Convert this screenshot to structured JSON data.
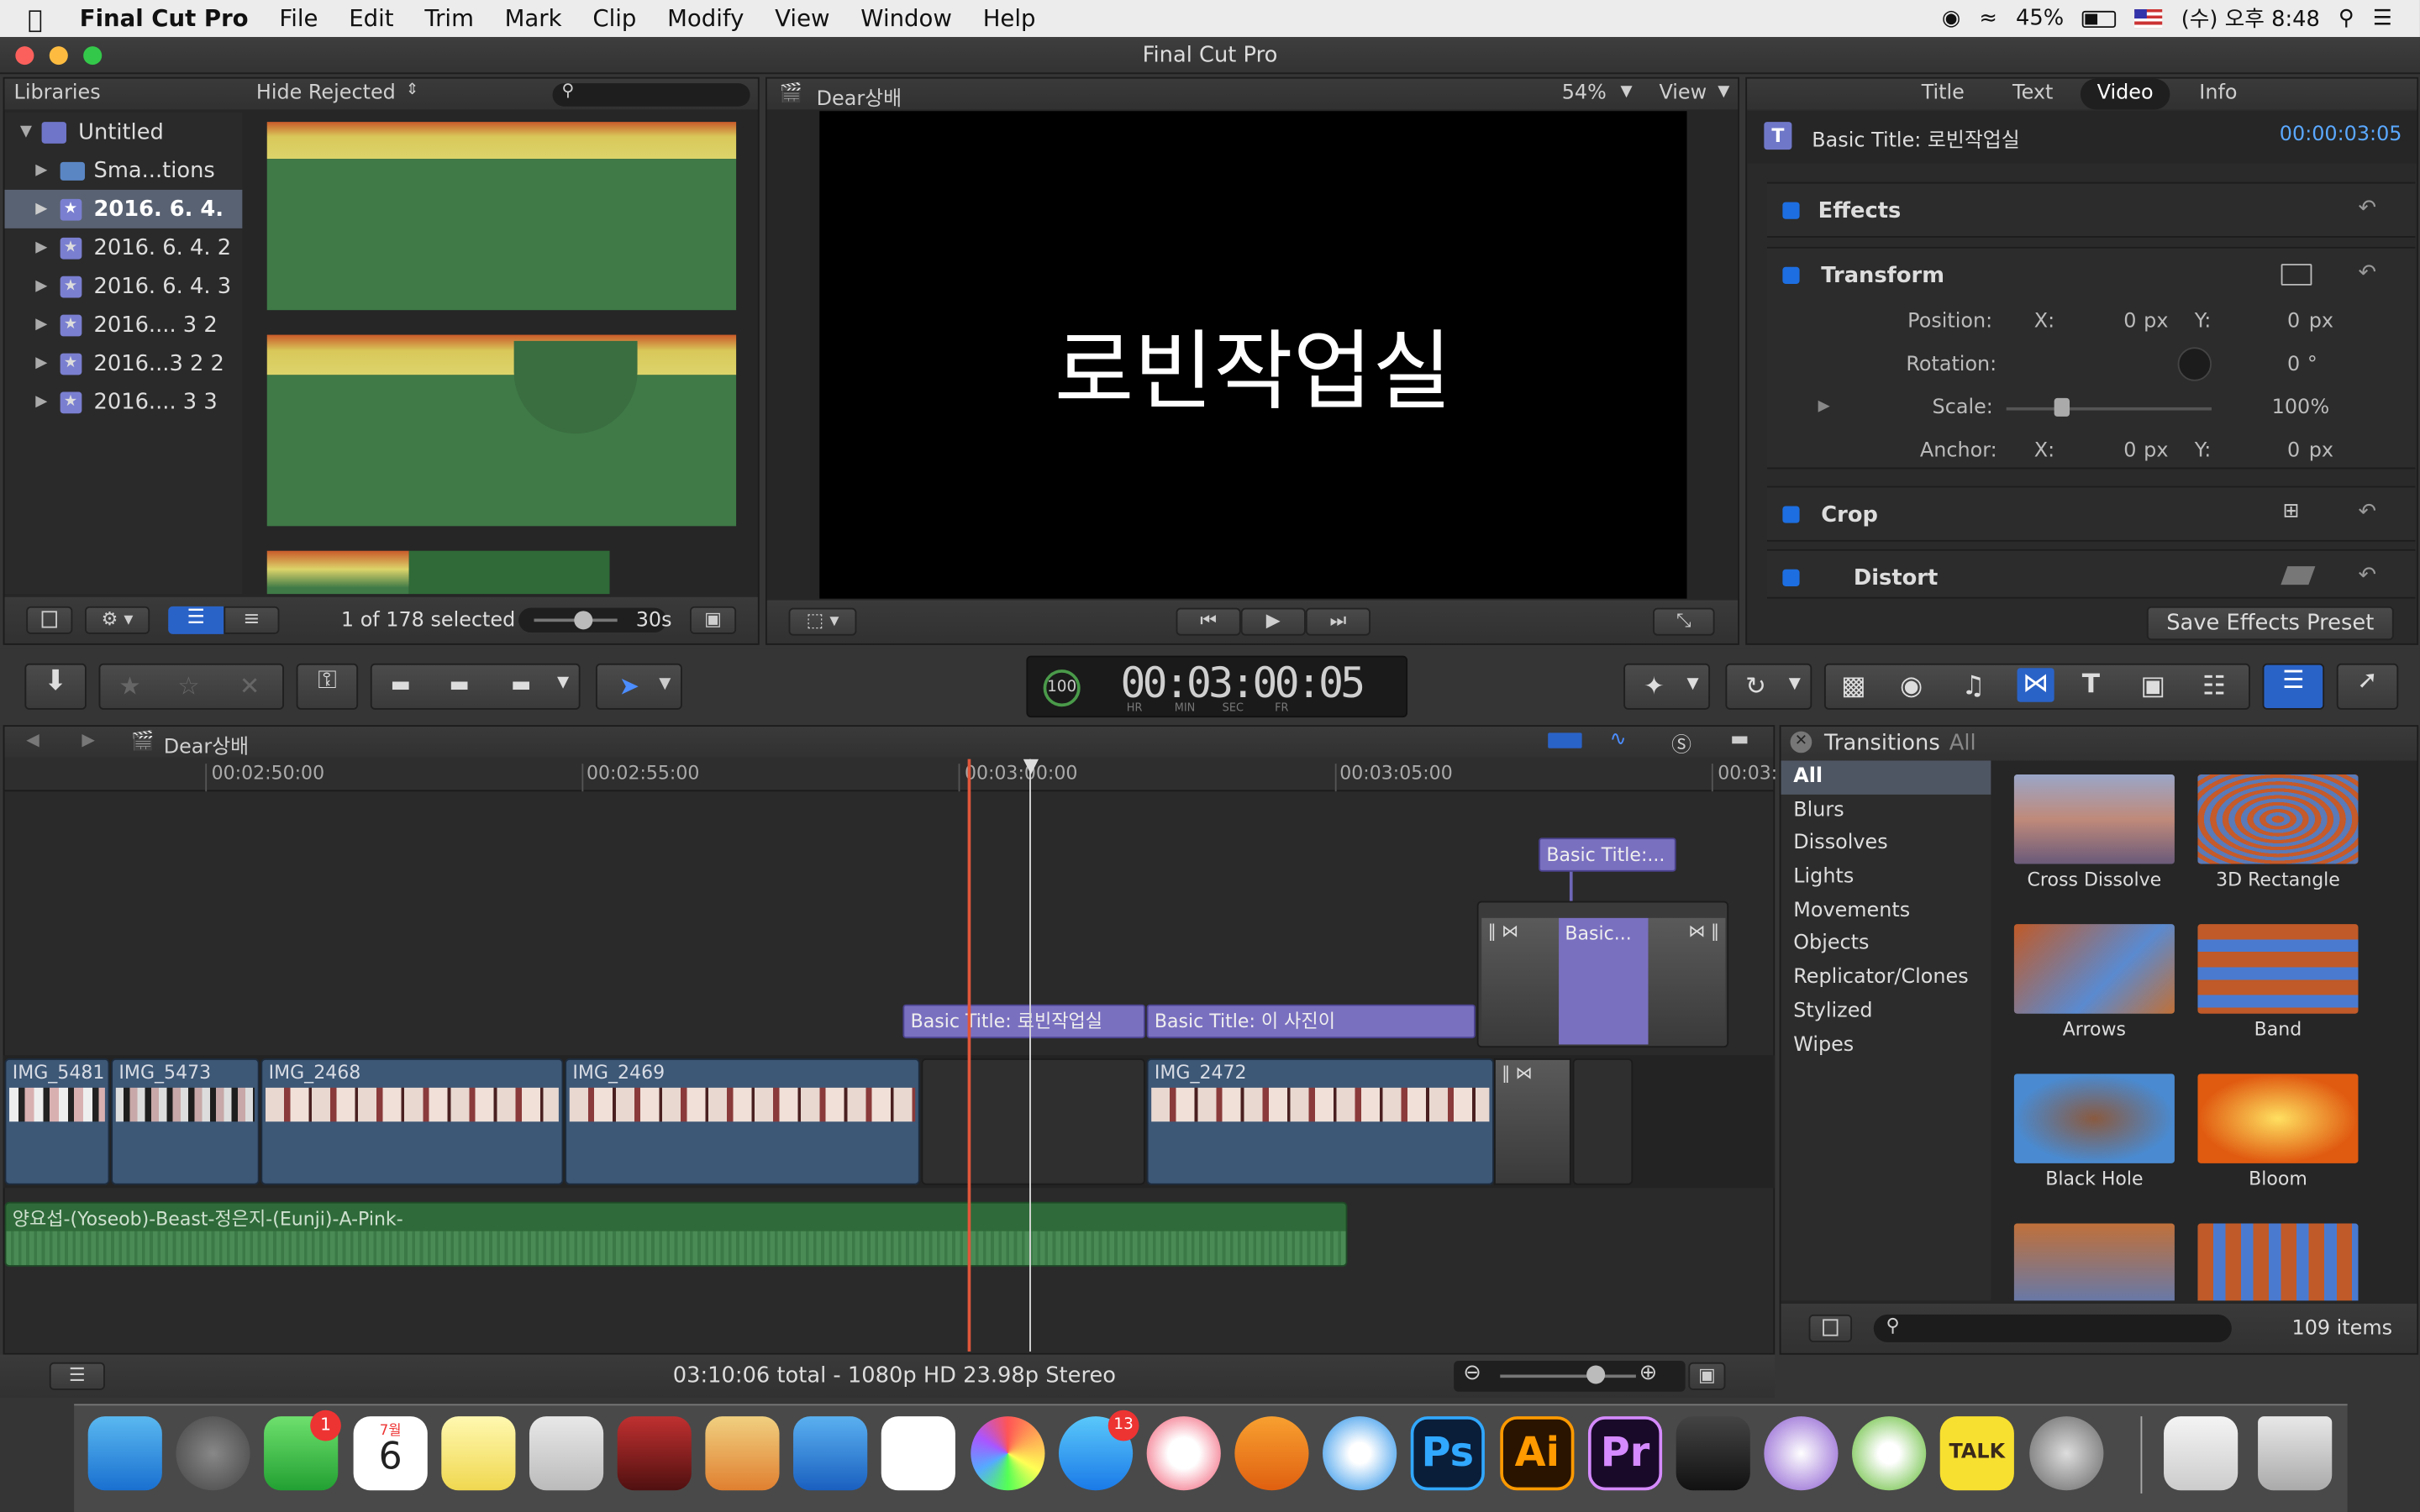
{
  "menubar": {
    "app_name": "Final Cut Pro",
    "items": [
      "File",
      "Edit",
      "Trim",
      "Mark",
      "Clip",
      "Modify",
      "View",
      "Window",
      "Help"
    ],
    "battery": "45%",
    "clock": "(수) 오후 8:48"
  },
  "window_title": "Final Cut Pro",
  "libraries": {
    "header": "Libraries",
    "filter": "Hide Rejected",
    "items": [
      {
        "label": "Untitled"
      },
      {
        "label": "Sma...tions"
      },
      {
        "label": "2016. 6. 4."
      },
      {
        "label": "2016. 6. 4. 2"
      },
      {
        "label": "2016. 6. 4. 3"
      },
      {
        "label": "2016.... 3 2"
      },
      {
        "label": "2016...3 2 2"
      },
      {
        "label": "2016.... 3 3"
      }
    ],
    "selection_status": "1 of 178 selected",
    "duration": "30s"
  },
  "viewer": {
    "project_name": "Dear상배",
    "zoom": "54%",
    "view_label": "View",
    "overlay_text": "로빈작업실"
  },
  "inspector": {
    "tabs": [
      "Title",
      "Text",
      "Video",
      "Info"
    ],
    "active_tab": "Video",
    "clip_name": "Basic Title: 로빈작업실",
    "clip_duration": "00:00:03:05",
    "sections": {
      "effects": "Effects",
      "transform": "Transform",
      "crop": "Crop",
      "distort": "Distort"
    },
    "params": {
      "position_label": "Position:",
      "rotation_label": "Rotation:",
      "scale_label": "Scale:",
      "anchor_label": "Anchor:",
      "x": "X:",
      "y": "Y:",
      "pos_x": "0",
      "pos_y": "0",
      "px": "px",
      "rotation": "0",
      "deg": "°",
      "scale": "100",
      "pct": "%",
      "anchor_x": "0",
      "anchor_y": "0"
    },
    "save_preset": "Save Effects Preset"
  },
  "timecode": {
    "value": "00:03:00:05",
    "speed": "100",
    "units": [
      "HR",
      "MIN",
      "SEC",
      "FR"
    ]
  },
  "timeline": {
    "project_name": "Dear상배",
    "ruler": [
      "00:02:50:00",
      "00:02:55:00",
      "00:03:00:00",
      "00:03:05:00",
      "00:03:"
    ],
    "clips": [
      "IMG_5481",
      "IMG_5473",
      "IMG_2468",
      "IMG_2469",
      "IMG_2472"
    ],
    "titles": [
      "Basic Title: 로빈작업실",
      "Basic Title: 이 사진이",
      "Basic Title:...",
      "Basic..."
    ],
    "audio": "양요섭-(Yoseob)-Beast-정은지-(Eunji)-A-Pink-",
    "status": "03:10:06 total - 1080p HD 23.98p Stereo"
  },
  "transitions": {
    "header": "Transitions",
    "filter": "All",
    "categories": [
      "All",
      "Blurs",
      "Dissolves",
      "Lights",
      "Movements",
      "Objects",
      "Replicator/Clones",
      "Stylized",
      "Wipes"
    ],
    "items": [
      "Cross Dissolve",
      "3D Rectangle",
      "Arrows",
      "Band",
      "Black Hole",
      "Bloom"
    ],
    "count": "109 items"
  },
  "dock": {
    "facetime_badge": "1",
    "calendar_month": "7월",
    "calendar_day": "6",
    "appstore_badge": "13",
    "ps": "Ps",
    "ai": "Ai",
    "pr": "Pr",
    "talk": "TALK"
  }
}
